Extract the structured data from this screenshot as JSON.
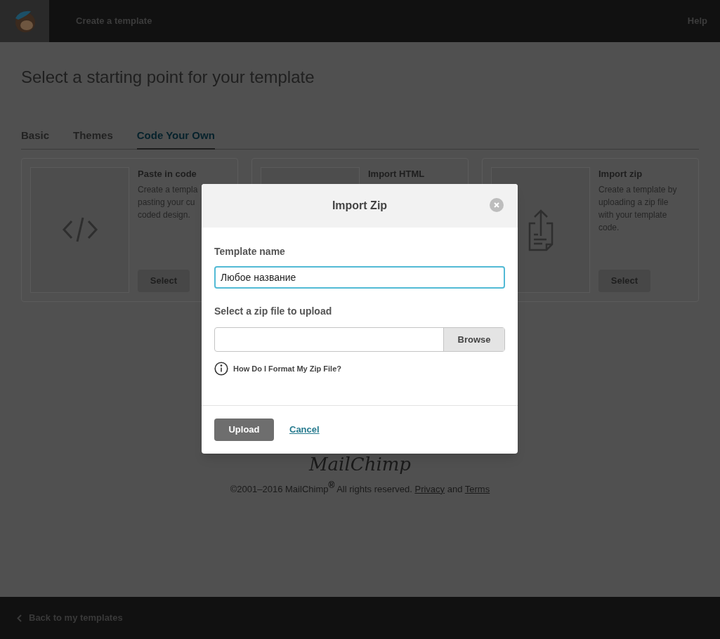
{
  "header": {
    "title": "Create a template",
    "help": "Help"
  },
  "page_title": "Select a starting point for your template",
  "tabs": [
    {
      "label": "Basic",
      "selected": false
    },
    {
      "label": "Themes",
      "selected": false
    },
    {
      "label": "Code Your Own",
      "selected": true
    }
  ],
  "cards": [
    {
      "kind": "code",
      "title": "Paste in code",
      "lines": [
        "Create a templa",
        "pasting your cu",
        "coded design."
      ],
      "button": "Select"
    },
    {
      "kind": "html",
      "title": "Import HTML"
    },
    {
      "kind": "zip",
      "title": "Import zip",
      "lines": [
        "Create a template by",
        "uploading a zip file",
        "with your template",
        "code."
      ],
      "button": "Select"
    }
  ],
  "footer": {
    "logo": "MailChimp",
    "copyright": "©2001–2016 MailChimp$^{®}$ All rights reserved.",
    "privacy": "Privacy",
    "and": "and",
    "terms": "Terms"
  },
  "bottom_bar": {
    "back": "Back to my templates"
  },
  "modal": {
    "title": "Import Zip",
    "name_label": "Template name",
    "name_value": "Любое название",
    "file_label": "Select a zip file to upload",
    "browse": "Browse",
    "help_link": "How Do I Format My Zip File?",
    "upload": "Upload",
    "cancel": "Cancel"
  }
}
